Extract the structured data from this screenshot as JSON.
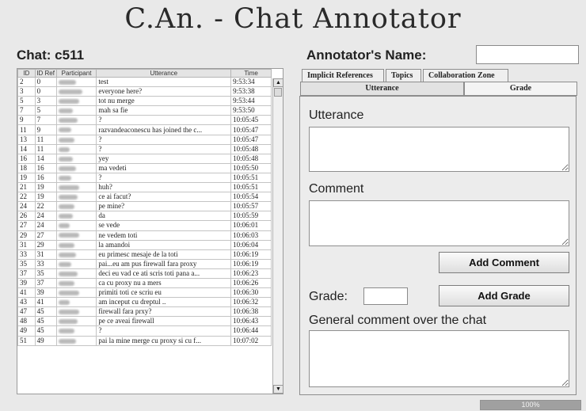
{
  "app": {
    "title": "C.An. - Chat Annotator"
  },
  "chat": {
    "title": "Chat: c511",
    "columns": [
      "ID",
      "ID Ref",
      "Participant",
      "Utterance",
      "Time"
    ],
    "rows": [
      {
        "id": "2",
        "ref": "0",
        "utterance": "test",
        "time": "9:53:34"
      },
      {
        "id": "3",
        "ref": "0",
        "utterance": "everyone here?",
        "time": "9:53:38"
      },
      {
        "id": "5",
        "ref": "3",
        "utterance": "tot nu merge",
        "time": "9:53:44"
      },
      {
        "id": "7",
        "ref": "5",
        "utterance": "mah sa fie",
        "time": "9:53:50"
      },
      {
        "id": "9",
        "ref": "7",
        "utterance": "?",
        "time": "10:05:45"
      },
      {
        "id": "11",
        "ref": "9",
        "utterance": "razvandeaconescu has joined the c...",
        "time": "10:05:47"
      },
      {
        "id": "13",
        "ref": "11",
        "utterance": "?",
        "time": "10:05:47"
      },
      {
        "id": "14",
        "ref": "11",
        "utterance": "?",
        "time": "10:05:48"
      },
      {
        "id": "16",
        "ref": "14",
        "utterance": "yey",
        "time": "10:05:48"
      },
      {
        "id": "18",
        "ref": "16",
        "utterance": "ma vedeti",
        "time": "10:05:50"
      },
      {
        "id": "19",
        "ref": "16",
        "utterance": "?",
        "time": "10:05:51"
      },
      {
        "id": "21",
        "ref": "19",
        "utterance": "huh?",
        "time": "10:05:51"
      },
      {
        "id": "22",
        "ref": "19",
        "utterance": "ce ai facut?",
        "time": "10:05:54"
      },
      {
        "id": "24",
        "ref": "22",
        "utterance": "pe mine?",
        "time": "10:05:57"
      },
      {
        "id": "26",
        "ref": "24",
        "utterance": "da",
        "time": "10:05:59"
      },
      {
        "id": "27",
        "ref": "24",
        "utterance": "se vede",
        "time": "10:06:01"
      },
      {
        "id": "29",
        "ref": "27",
        "utterance": "ne vedem toti",
        "time": "10:06:03"
      },
      {
        "id": "31",
        "ref": "29",
        "utterance": "la amandoi",
        "time": "10:06:04"
      },
      {
        "id": "33",
        "ref": "31",
        "utterance": "eu primesc mesaje de la toti",
        "time": "10:06:19"
      },
      {
        "id": "35",
        "ref": "33",
        "utterance": "pai...eu am pus firewall fara proxy",
        "time": "10:06:19"
      },
      {
        "id": "37",
        "ref": "35",
        "utterance": "deci eu vad ce ati scris toti pana a...",
        "time": "10:06:23"
      },
      {
        "id": "39",
        "ref": "37",
        "utterance": "ca cu proxy nu a mers",
        "time": "10:06:26"
      },
      {
        "id": "41",
        "ref": "39",
        "utterance": "primiti toti ce scriu eu",
        "time": "10:06:30"
      },
      {
        "id": "43",
        "ref": "41",
        "utterance": "am inceput cu dreptul ..",
        "time": "10:06:32"
      },
      {
        "id": "47",
        "ref": "45",
        "utterance": "firewall fara prxy?",
        "time": "10:06:38"
      },
      {
        "id": "48",
        "ref": "45",
        "utterance": "pe ce aveai firewall",
        "time": "10:06:43"
      },
      {
        "id": "49",
        "ref": "45",
        "utterance": "?",
        "time": "10:06:44"
      },
      {
        "id": "51",
        "ref": "49",
        "utterance": "pai la mine merge cu proxy si cu f...",
        "time": "10:07:02"
      }
    ]
  },
  "annotator": {
    "label": "Annotator's Name:",
    "value": ""
  },
  "tabs": {
    "top": [
      "Implicit References",
      "Topics",
      "Collaboration Zone"
    ],
    "second": [
      "Utterance",
      "Grade"
    ]
  },
  "panel": {
    "utterance_label": "Utterance",
    "comment_label": "Comment",
    "add_comment": "Add Comment",
    "grade_label": "Grade:",
    "add_grade": "Add Grade",
    "general_label": "General comment over the chat"
  },
  "status": {
    "progress_text": "100%",
    "progress_fraction": 1.0
  }
}
